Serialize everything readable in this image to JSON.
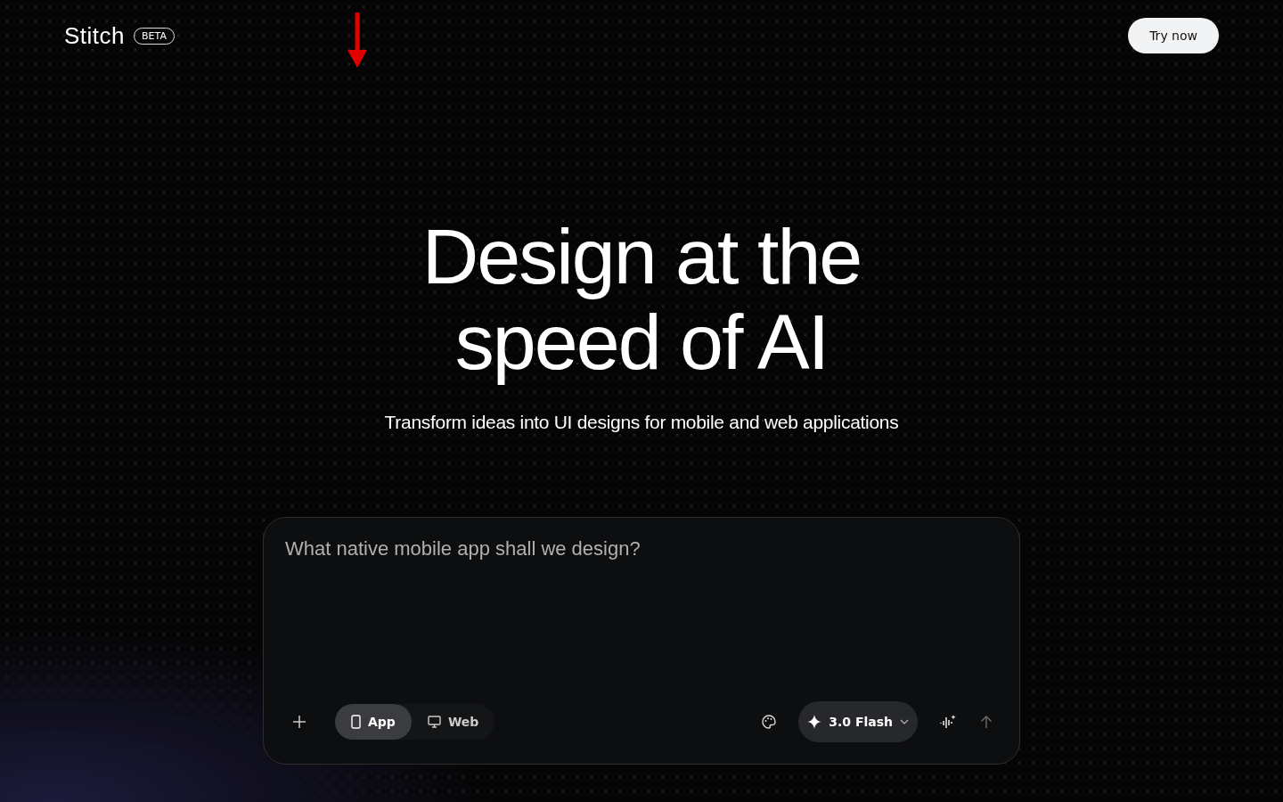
{
  "header": {
    "logo": "Stitch",
    "badge": "BETA",
    "cta": "Try now"
  },
  "hero": {
    "title_lines": [
      "Design at the",
      "speed of AI"
    ],
    "subtitle": "Transform ideas into UI designs for mobile and web applications"
  },
  "prompt": {
    "placeholder": "What native mobile app shall we design?",
    "modes": [
      {
        "kind": "phone",
        "label": "App",
        "selected": true
      },
      {
        "kind": "monitor",
        "label": "Web",
        "selected": false
      }
    ],
    "model": "3.0 Flash"
  },
  "annotation": {
    "kind": "down-arrow"
  }
}
